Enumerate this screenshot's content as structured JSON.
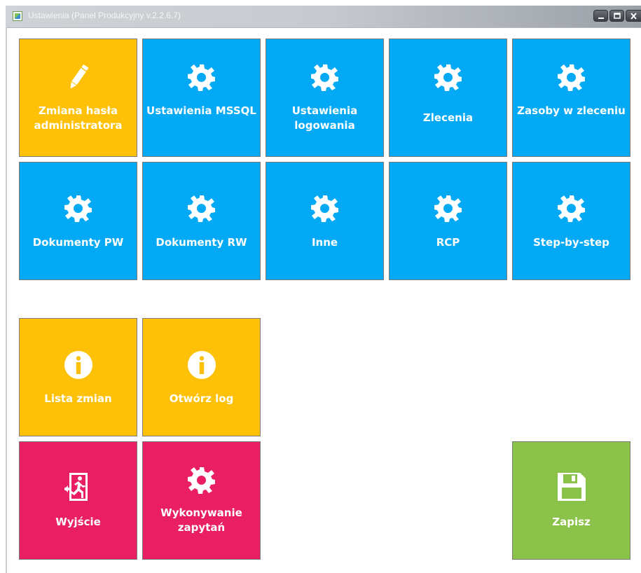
{
  "window": {
    "title": "Ustawienia (Panel Produkcyjny v.2.2.6.7)"
  },
  "colors": {
    "blue": "#03a9f4",
    "yellow": "#ffc107",
    "pink": "#e91e63",
    "green": "#8bc34a"
  },
  "tiles": {
    "admin_password": "Zmiana hasła administratora",
    "mssql_settings": "Ustawienia MSSQL",
    "login_settings": "Ustawienia logowania",
    "orders": "Zlecenia",
    "order_resources": "Zasoby w zleceniu",
    "pw_documents": "Dokumenty PW",
    "rw_documents": "Dokumenty RW",
    "other": "Inne",
    "rcp": "RCP",
    "step_by_step": "Step-by-step",
    "changelog": "Lista zmian",
    "open_log": "Otwórz log",
    "exit": "Wyjście",
    "run_queries": "Wykonywanie zapytań",
    "save": "Zapisz"
  },
  "icons": {
    "admin_password": "pencil-icon",
    "settings": "gear-icon",
    "info": "info-icon",
    "exit": "emergency-exit-icon",
    "save": "floppy-disk-icon"
  }
}
